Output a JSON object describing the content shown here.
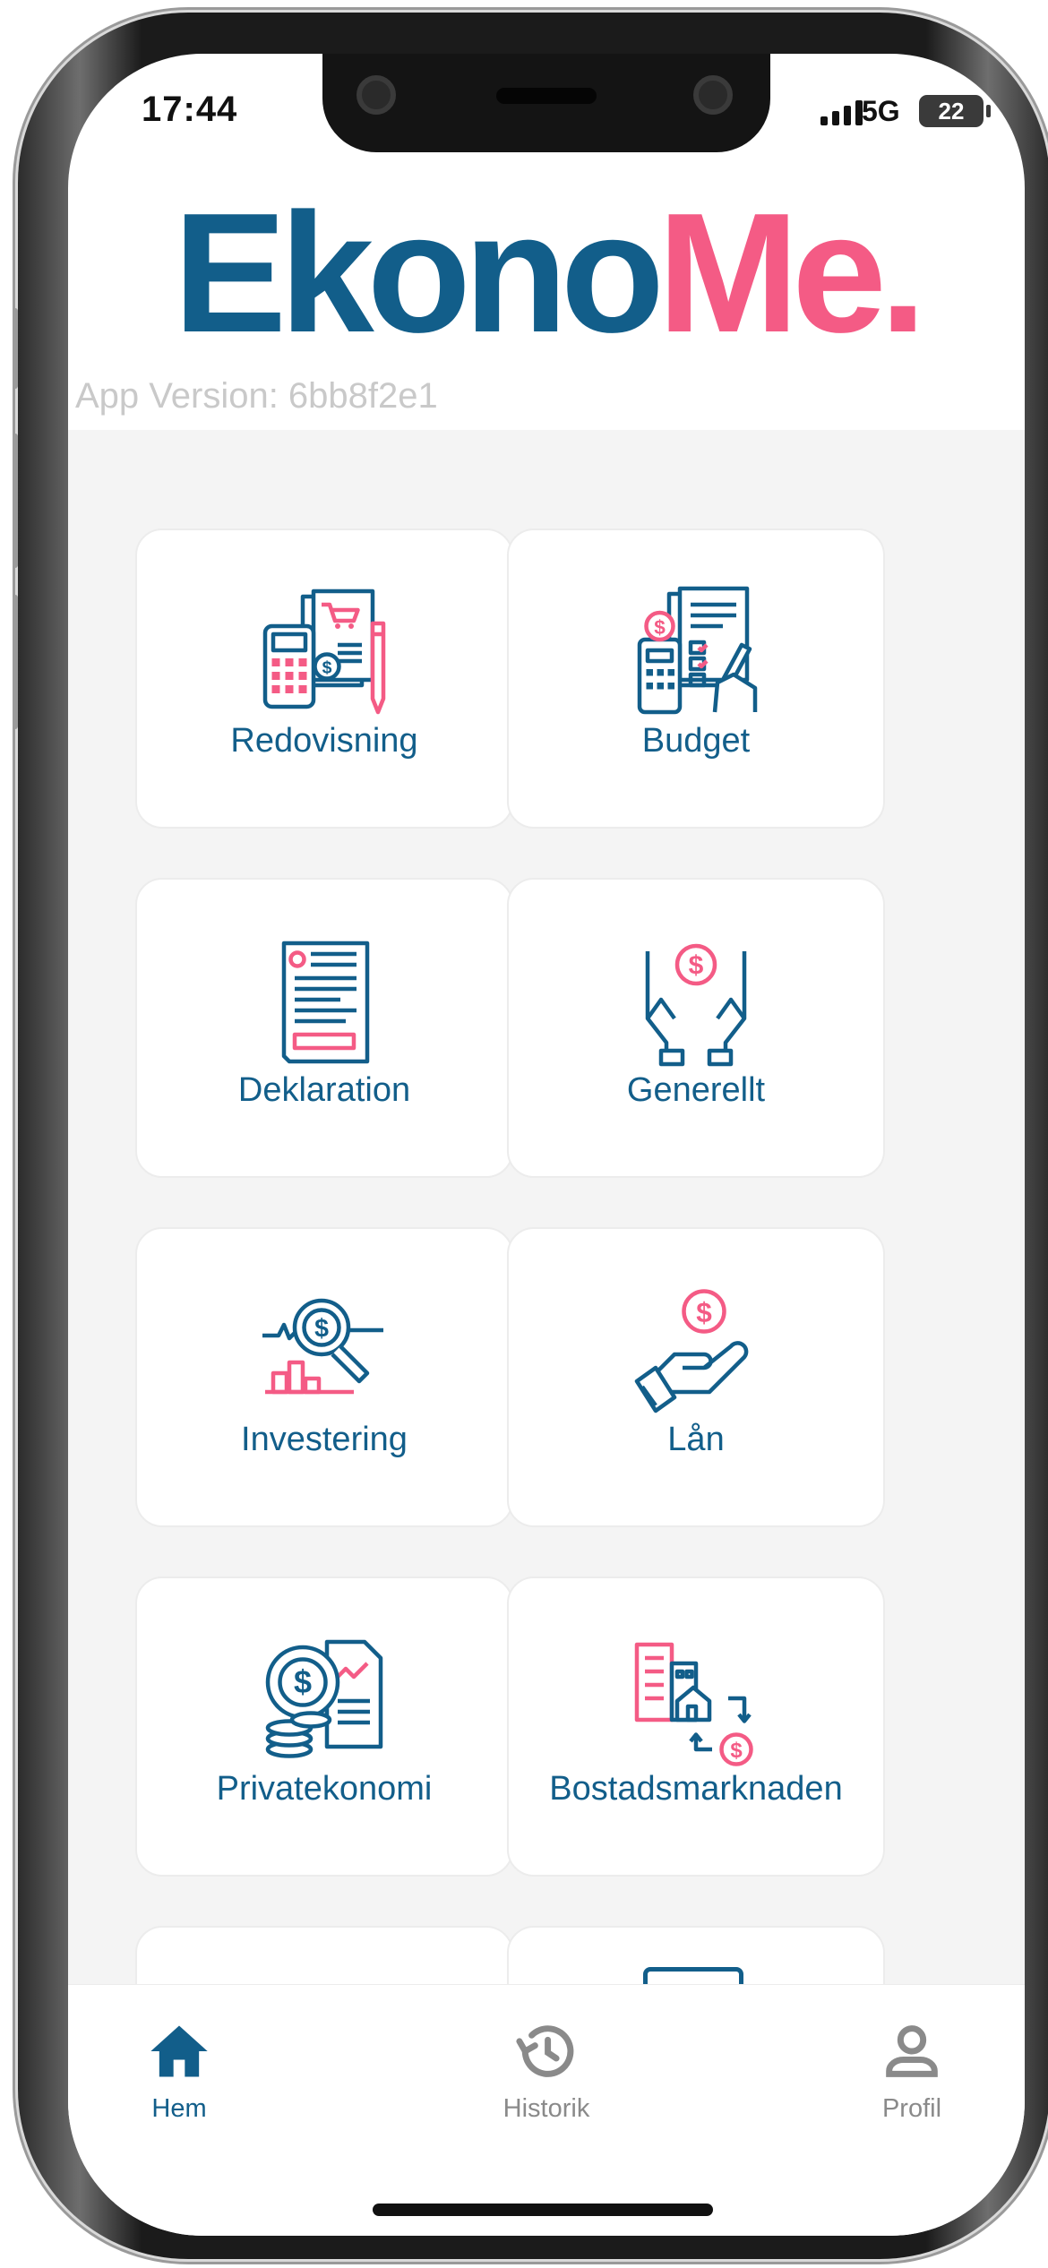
{
  "status_bar": {
    "time": "17:44",
    "network": "5G",
    "battery": "22"
  },
  "app": {
    "logo_part1": "Ekono",
    "logo_part2": "Me.",
    "version": "App Version: 6bb8f2e1"
  },
  "grid": {
    "items": [
      {
        "label": "Redovisning",
        "icon": "accounting-icon"
      },
      {
        "label": "Budget",
        "icon": "budget-icon"
      },
      {
        "label": "Deklaration",
        "icon": "tax-declaration-icon"
      },
      {
        "label": "Generellt",
        "icon": "hands-money-icon"
      },
      {
        "label": "Investering",
        "icon": "investment-search-icon"
      },
      {
        "label": "Lån",
        "icon": "loan-hand-icon"
      },
      {
        "label": "Privatekonomi",
        "icon": "personal-finance-icon"
      },
      {
        "label": "Bostadsmarknaden",
        "icon": "housing-market-icon"
      }
    ]
  },
  "tabbar": {
    "tabs": [
      {
        "label": "Hem",
        "icon": "home-icon",
        "active": true
      },
      {
        "label": "Historik",
        "icon": "history-icon",
        "active": false
      },
      {
        "label": "Profil",
        "icon": "profile-icon",
        "active": false
      }
    ]
  },
  "colors": {
    "brand_blue": "#125e8a",
    "brand_pink": "#f45b85",
    "inactive_grey": "#8a8a8a"
  }
}
